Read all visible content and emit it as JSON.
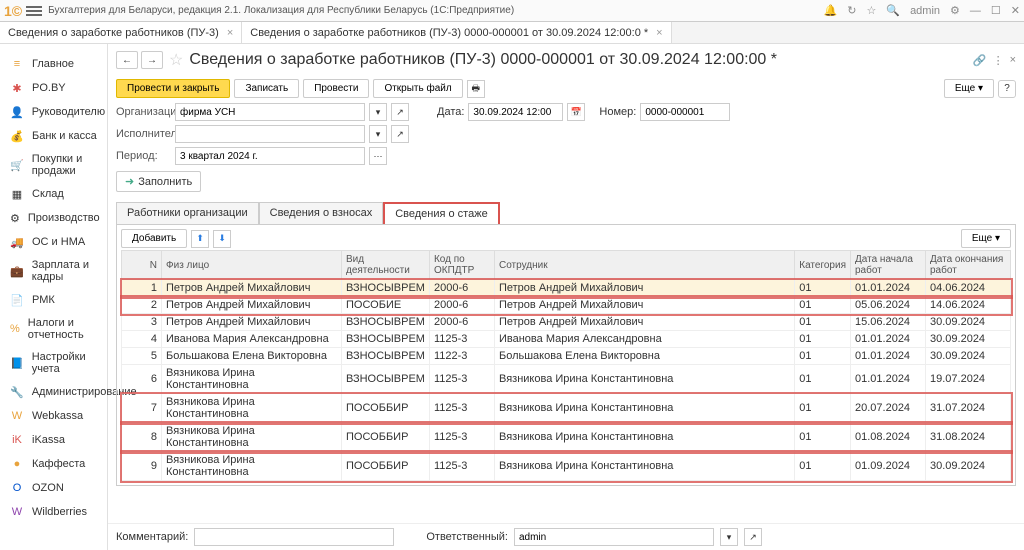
{
  "top": {
    "title": "Бухгалтерия для Беларуси, редакция 2.1. Локализация для Республики Беларусь   (1С:Предприятие)",
    "user": "admin"
  },
  "tabs": {
    "t1": "Сведения о заработке работников (ПУ-3)",
    "t2": "Сведения о заработке работников (ПУ-3) 0000-000001 от 30.09.2024 12:00:0 *"
  },
  "sidebar": {
    "items": [
      {
        "icon": "≡",
        "label": "Главное",
        "color": "#e8a33d"
      },
      {
        "icon": "✱",
        "label": "PO.BY",
        "color": "#d9534f"
      },
      {
        "icon": "👤",
        "label": "Руководителю",
        "color": "#e8a33d"
      },
      {
        "icon": "💰",
        "label": "Банк и касса",
        "color": "#d9534f"
      },
      {
        "icon": "🛒",
        "label": "Покупки и продажи",
        "color": "#333"
      },
      {
        "icon": "▦",
        "label": "Склад",
        "color": "#333"
      },
      {
        "icon": "⚙",
        "label": "Производство",
        "color": "#333"
      },
      {
        "icon": "🚚",
        "label": "ОС и НМА",
        "color": "#333"
      },
      {
        "icon": "💼",
        "label": "Зарплата и кадры",
        "color": "#333"
      },
      {
        "icon": "📄",
        "label": "РМК",
        "color": "#d9534f"
      },
      {
        "icon": "%",
        "label": "Налоги и отчетность",
        "color": "#e8a33d"
      },
      {
        "icon": "📘",
        "label": "Настройки учета",
        "color": "#d9534f"
      },
      {
        "icon": "🔧",
        "label": "Администрирование",
        "color": "#666"
      },
      {
        "icon": "W",
        "label": "Webkassa",
        "color": "#e8a33d"
      },
      {
        "icon": "iK",
        "label": "iKassa",
        "color": "#d9534f"
      },
      {
        "icon": "●",
        "label": "Каффеста",
        "color": "#e8a33d"
      },
      {
        "icon": "O",
        "label": "OZON",
        "color": "#0052cc"
      },
      {
        "icon": "W",
        "label": "Wildberries",
        "color": "#8e44ad"
      }
    ]
  },
  "header": {
    "doc_title": "Сведения о заработке работников (ПУ-3) 0000-000001 от 30.09.2024 12:00:00 *"
  },
  "toolbar": {
    "post_close": "Провести и закрыть",
    "save": "Записать",
    "post": "Провести",
    "open_file": "Открыть файл",
    "more": "Еще ▾",
    "help": "?"
  },
  "form": {
    "org_label": "Организация:",
    "org_value": "фирма УСН",
    "date_label": "Дата:",
    "date_value": "30.09.2024 12:00",
    "num_label": "Номер:",
    "num_value": "0000-000001",
    "exec_label": "Исполнитель:",
    "exec_value": "",
    "period_label": "Период:",
    "period_value": "3 квартал 2024 г.",
    "fill": "Заполнить"
  },
  "subtabs": {
    "t1": "Работники организации",
    "t2": "Сведения о взносах",
    "t3": "Сведения о стаже"
  },
  "tabtoolbar": {
    "add": "Добавить",
    "up": "⬆",
    "down": "⬇",
    "more": "Еще ▾"
  },
  "columns": {
    "n": "N",
    "fiz": "Физ лицо",
    "vid": "Вид деятельности",
    "okp": "Код по ОКПДТР",
    "sotr": "Сотрудник",
    "kat": "Категория",
    "dstart": "Дата начала работ",
    "dend": "Дата окончания работ"
  },
  "rows": [
    {
      "n": "1",
      "fiz": "Петров Андрей Михайлович",
      "vid": "ВЗНОСЫВРЕМ",
      "okp": "2000-6",
      "sotr": "Петров Андрей Михайлович",
      "kat": "01",
      "ds": "01.01.2024",
      "de": "04.06.2024"
    },
    {
      "n": "2",
      "fiz": "Петров Андрей Михайлович",
      "vid": "ПОСОБИЕ",
      "okp": "2000-6",
      "sotr": "Петров Андрей Михайлович",
      "kat": "01",
      "ds": "05.06.2024",
      "de": "14.06.2024"
    },
    {
      "n": "3",
      "fiz": "Петров Андрей Михайлович",
      "vid": "ВЗНОСЫВРЕМ",
      "okp": "2000-6",
      "sotr": "Петров Андрей Михайлович",
      "kat": "01",
      "ds": "15.06.2024",
      "de": "30.09.2024"
    },
    {
      "n": "4",
      "fiz": "Иванова Мария Александровна",
      "vid": "ВЗНОСЫВРЕМ",
      "okp": "1125-3",
      "sotr": "Иванова Мария Александровна",
      "kat": "01",
      "ds": "01.01.2024",
      "de": "30.09.2024"
    },
    {
      "n": "5",
      "fiz": "Большакова Елена Викторовна",
      "vid": "ВЗНОСЫВРЕМ",
      "okp": "1122-3",
      "sotr": "Большакова Елена Викторовна",
      "kat": "01",
      "ds": "01.01.2024",
      "de": "30.09.2024"
    },
    {
      "n": "6",
      "fiz": "Вязникова Ирина Константиновна",
      "vid": "ВЗНОСЫВРЕМ",
      "okp": "1125-3",
      "sotr": "Вязникова Ирина Константиновна",
      "kat": "01",
      "ds": "01.01.2024",
      "de": "19.07.2024"
    },
    {
      "n": "7",
      "fiz": "Вязникова Ирина Константиновна",
      "vid": "ПОСОББИР",
      "okp": "1125-3",
      "sotr": "Вязникова Ирина Константиновна",
      "kat": "01",
      "ds": "20.07.2024",
      "de": "31.07.2024"
    },
    {
      "n": "8",
      "fiz": "Вязникова Ирина Константиновна",
      "vid": "ПОСОББИР",
      "okp": "1125-3",
      "sotr": "Вязникова Ирина Константиновна",
      "kat": "01",
      "ds": "01.08.2024",
      "de": "31.08.2024"
    },
    {
      "n": "9",
      "fiz": "Вязникова Ирина Константиновна",
      "vid": "ПОСОББИР",
      "okp": "1125-3",
      "sotr": "Вязникова Ирина Константиновна",
      "kat": "01",
      "ds": "01.09.2024",
      "de": "30.09.2024"
    }
  ],
  "bottom": {
    "comment_label": "Комментарий:",
    "comment_value": "",
    "resp_label": "Ответственный:",
    "resp_value": "admin"
  }
}
